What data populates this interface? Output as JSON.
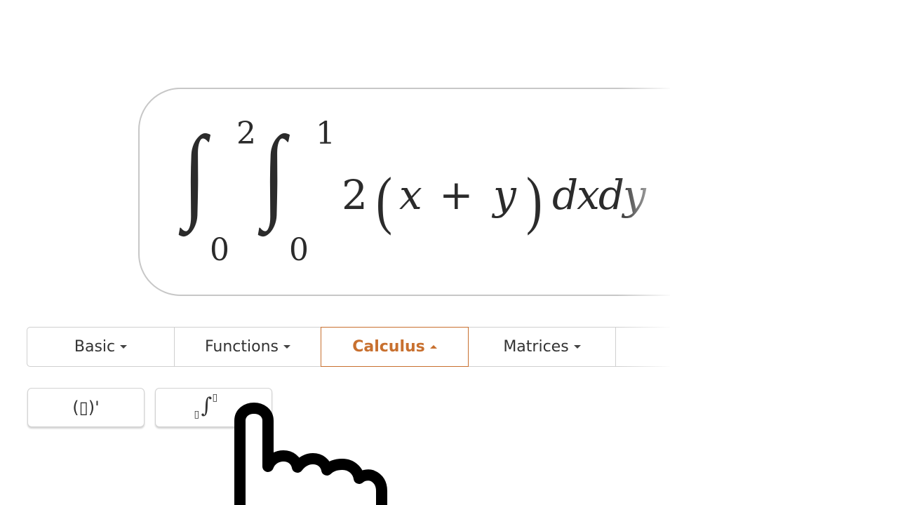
{
  "expression": {
    "integral_1": {
      "upper": "2",
      "lower": "0"
    },
    "integral_2": {
      "upper": "1",
      "lower": "0"
    },
    "coefficient": "2",
    "open_paren": "(",
    "var_x": "x",
    "plus": "+",
    "var_y": "y",
    "close_paren": ")",
    "differentials": "dxdy"
  },
  "tabs": [
    {
      "label": "Basic",
      "active": false
    },
    {
      "label": "Functions",
      "active": false
    },
    {
      "label": "Calculus",
      "active": true
    },
    {
      "label": "Matrices",
      "active": false
    }
  ],
  "buttons": {
    "derivative": "(▯)'",
    "integral": {
      "lower": "▯",
      "upper": "▯",
      "symbol": "∫"
    }
  },
  "colors": {
    "accent": "#c8702f",
    "text": "#333333",
    "border": "#cfcfcf"
  },
  "icons": {
    "cursor": "hand-pointer-icon",
    "caret_down": "caret-down-icon",
    "caret_up": "caret-up-icon"
  }
}
